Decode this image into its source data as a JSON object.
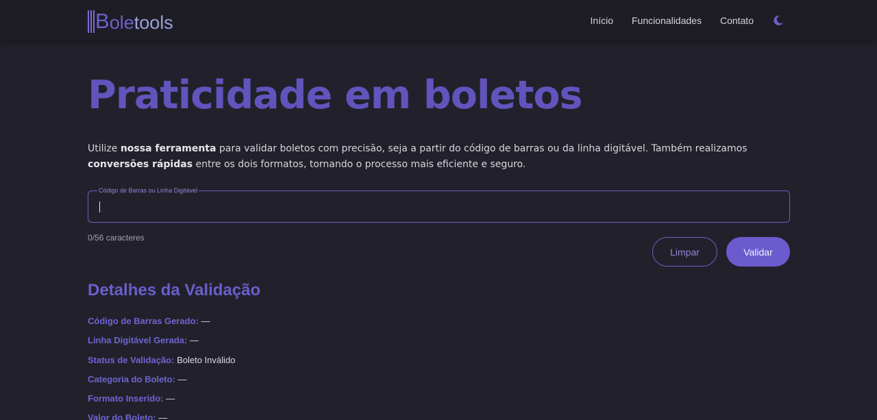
{
  "brand": {
    "logo_b": "B",
    "logo_ole": "ole",
    "logo_tools": "tools"
  },
  "nav": {
    "items": [
      "Início",
      "Funcionalidades",
      "Contato"
    ],
    "theme_icon": "moon-icon"
  },
  "hero": {
    "title": "Praticidade em boletos"
  },
  "intro": {
    "p1": "Utilize ",
    "b1": "nossa ferramenta",
    "p2": " para validar boletos com precisão, seja a partir do código de barras ou da linha digitável. Também realizamos ",
    "b2": "conversões rápidas",
    "p3": " entre os dois formatos, tornando o processo mais eficiente e seguro."
  },
  "input": {
    "label": "Código de Barras ou Linha Digitável",
    "value": "",
    "counter": "0/56 caracteres"
  },
  "buttons": {
    "clear": "Limpar",
    "validate": "Validar"
  },
  "details": {
    "title": "Detalhes da Validação",
    "rows": [
      {
        "key": "Código de Barras Gerado:",
        "value": "—"
      },
      {
        "key": "Linha Digitável Gerada:",
        "value": "—"
      },
      {
        "key": "Status de Validação:",
        "value": "Boleto Inválido"
      },
      {
        "key": "Categoria do Boleto:",
        "value": "—"
      },
      {
        "key": "Formato Inserido:",
        "value": "—"
      },
      {
        "key": "Valor do Boleto:",
        "value": "—"
      }
    ]
  },
  "colors": {
    "accent": "#6b5bcf",
    "background": "#22212b",
    "header": "#1e1d26"
  }
}
